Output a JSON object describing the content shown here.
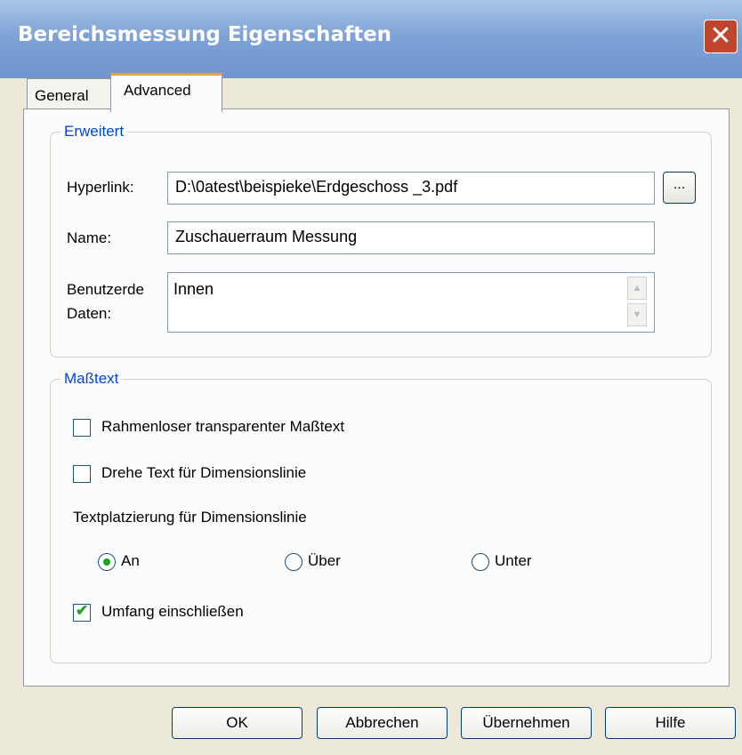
{
  "window": {
    "title": "Bereichsmessung Eigenschaften",
    "close_icon": "close-icon"
  },
  "tabs": [
    {
      "label": "General",
      "selected": false
    },
    {
      "label": "Advanced",
      "selected": true
    }
  ],
  "erweitert": {
    "legend": "Erweitert",
    "hyperlink_label": "Hyperlink:",
    "hyperlink_value": "D:\\0atest\\beispieke\\Erdgeschoss _3.pdf",
    "browse_label": "...",
    "name_label": "Name:",
    "name_value": "Zuschauerraum Messung",
    "userdata_label_1": "Benutzerde",
    "userdata_label_2": "Daten:",
    "userdata_value": "Innen"
  },
  "masstext": {
    "legend": "Maßtext",
    "checkbox_frameless": {
      "label": "Rahmenloser transparenter Maßtext",
      "checked": false
    },
    "checkbox_rotate": {
      "label": "Drehe Text für Dimensionslinie",
      "checked": false
    },
    "placement_label": "Textplatzierung für Dimensionslinie",
    "radios": [
      {
        "label": "An",
        "selected": true
      },
      {
        "label": "Über",
        "selected": false
      },
      {
        "label": "Unter",
        "selected": false
      }
    ],
    "checkbox_perimeter": {
      "label": "Umfang einschließen",
      "checked": true
    }
  },
  "buttons": {
    "ok": "OK",
    "cancel": "Abbrechen",
    "apply": "Übernehmen",
    "help": "Hilfe"
  },
  "colors": {
    "titlebar": "#7fa3d6",
    "accent_tab": "#e6a23b",
    "legend": "#0046d5",
    "check": "#21a121"
  }
}
